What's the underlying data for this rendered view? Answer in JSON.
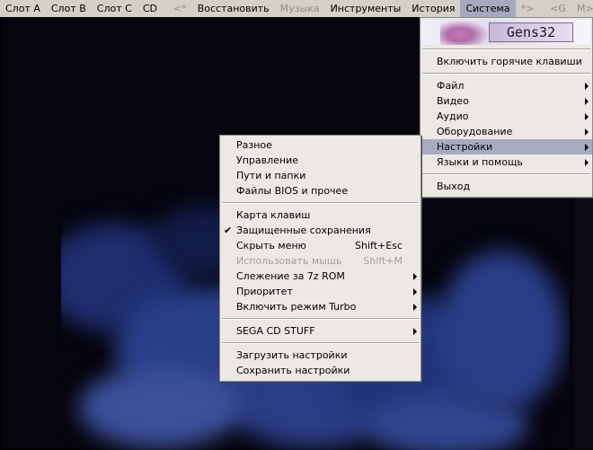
{
  "menubar": {
    "items": [
      {
        "label": "Слот A",
        "disabled": false
      },
      {
        "label": "Слот B",
        "disabled": false
      },
      {
        "label": "Слот C",
        "disabled": false
      },
      {
        "label": "CD",
        "disabled": false
      },
      {
        "label": "<*",
        "disabled": true
      },
      {
        "label": "Восстановить",
        "disabled": false
      },
      {
        "label": "Музыка",
        "disabled": true
      },
      {
        "label": "Инструменты",
        "disabled": false
      },
      {
        "label": "История",
        "disabled": false
      },
      {
        "label": "Система",
        "disabled": false,
        "active": true
      },
      {
        "label": "*>",
        "disabled": true
      },
      {
        "label": "<G",
        "disabled": true
      },
      {
        "label": "M>",
        "disabled": true
      }
    ]
  },
  "system_menu": {
    "logo_text": "Gens32",
    "hotkeys_item": "Включить горячие клавиши",
    "items": [
      {
        "label": "Файл"
      },
      {
        "label": "Видео"
      },
      {
        "label": "Аудио"
      },
      {
        "label": "Оборудование"
      },
      {
        "label": "Настройки",
        "highlighted": true
      },
      {
        "label": "Языки и помощь"
      }
    ],
    "exit_item": "Выход"
  },
  "settings_submenu": {
    "group1": [
      {
        "label": "Разное"
      },
      {
        "label": "Управление"
      },
      {
        "label": "Пути и папки"
      },
      {
        "label": "Файлы BIOS и прочее"
      }
    ],
    "group2": [
      {
        "label": "Карта клавиш"
      },
      {
        "label": "Защищенные сохранения",
        "checked": true
      },
      {
        "label": "Скрыть меню",
        "shortcut": "Shift+Esc"
      },
      {
        "label": "Использовать мышь",
        "shortcut": "Shift+M",
        "disabled": true
      },
      {
        "label": "Слежение за 7z ROM",
        "submenu": true
      },
      {
        "label": "Приоритет",
        "submenu": true
      },
      {
        "label": "Включить режим Turbo",
        "submenu": true
      }
    ],
    "group3": [
      {
        "label": "SEGA CD STUFF",
        "submenu": true
      }
    ],
    "group4": [
      {
        "label": "Загрузить настройки"
      },
      {
        "label": "Сохранить настройки"
      }
    ]
  },
  "colors": {
    "menubar_bg": "#d4d0c8",
    "menu_bg": "#ece9e4",
    "highlight": "#a9aac2",
    "disabled_text": "#a0a0a0",
    "game_blue": "#2a3f8a"
  }
}
